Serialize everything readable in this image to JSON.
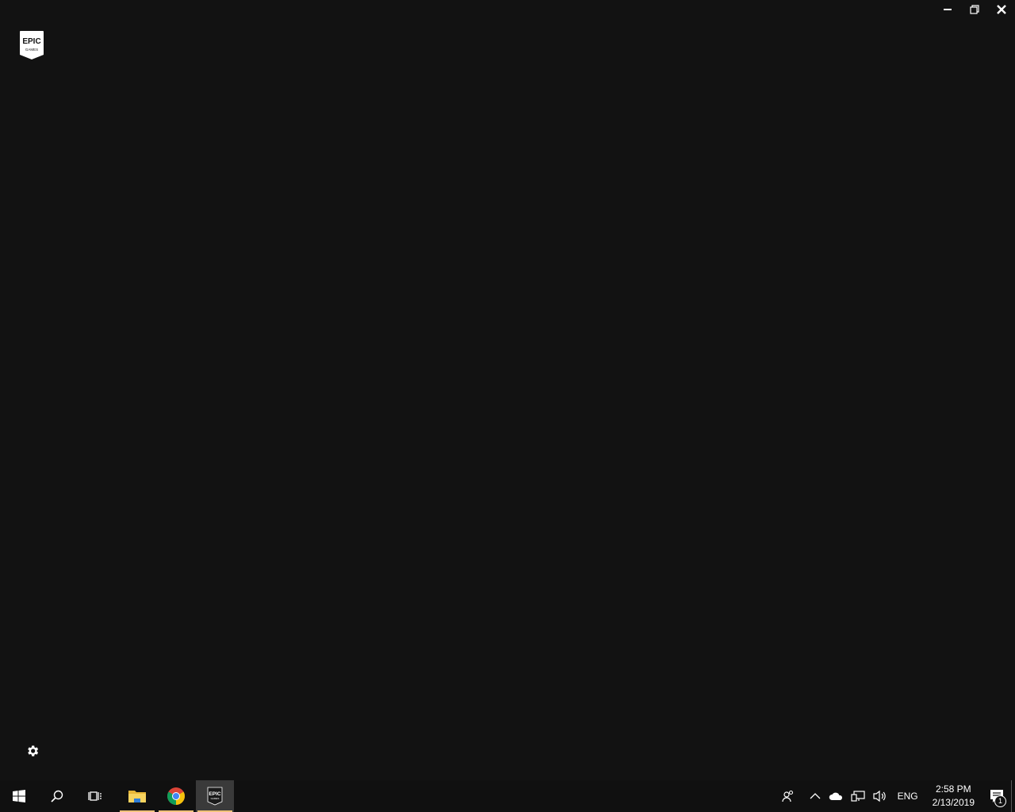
{
  "window": {
    "title": "Epic Games Launcher",
    "controls": {
      "minimize": "minimize-icon",
      "maximize": "restore-icon",
      "close": "close-icon"
    }
  },
  "logo": {
    "line1": "EPIC",
    "line2": "GAMES"
  },
  "settings": {
    "icon": "gear-icon"
  },
  "taskbar": {
    "start_icon": "windows-icon",
    "search_icon": "search-icon",
    "task_view_icon": "task-view-icon",
    "apps": [
      {
        "name": "File Explorer",
        "icon": "folder-icon",
        "running": true
      },
      {
        "name": "Google Chrome",
        "icon": "chrome-icon",
        "running": true
      },
      {
        "name": "Epic Games Launcher",
        "icon": "epic-icon",
        "running": true,
        "active": true
      }
    ],
    "tray": {
      "people_icon": "people-icon",
      "chevron_icon": "chevron-up-icon",
      "onedrive_icon": "cloud-icon",
      "network_icon": "network-icon",
      "volume_icon": "volume-icon",
      "language": "ENG",
      "time": "2:58 PM",
      "date": "2/13/2019",
      "notifications_count": "1"
    }
  },
  "colors": {
    "background": "#121212",
    "taskbar": "#101010",
    "running_indicator": "#f0c27a"
  }
}
